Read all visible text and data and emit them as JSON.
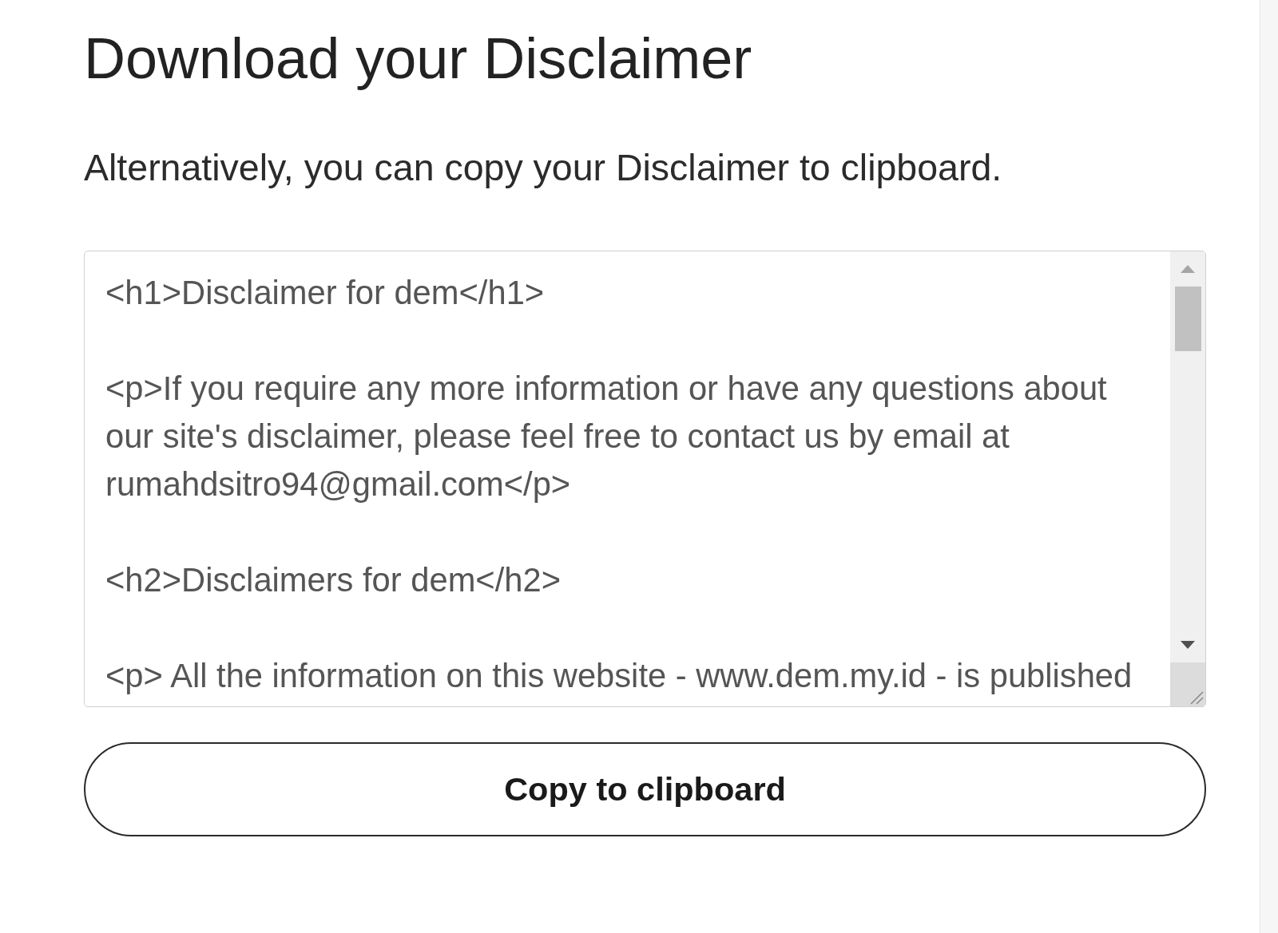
{
  "heading": "Download your Disclaimer",
  "intro": "Alternatively, you can copy your Disclaimer to clipboard.",
  "code_textarea": {
    "paragraphs": [
      "<h1>Disclaimer for dem</h1>",
      "<p>If you require any more information or have any questions about our site's disclaimer, please feel free to contact us by email at rumahdsitro94@gmail.com</p>",
      "<h2>Disclaimers for dem</h2>",
      "<p> All the information on this website - www.dem.my.id - is published"
    ]
  },
  "copy_button": {
    "label": "Copy to clipboard"
  }
}
